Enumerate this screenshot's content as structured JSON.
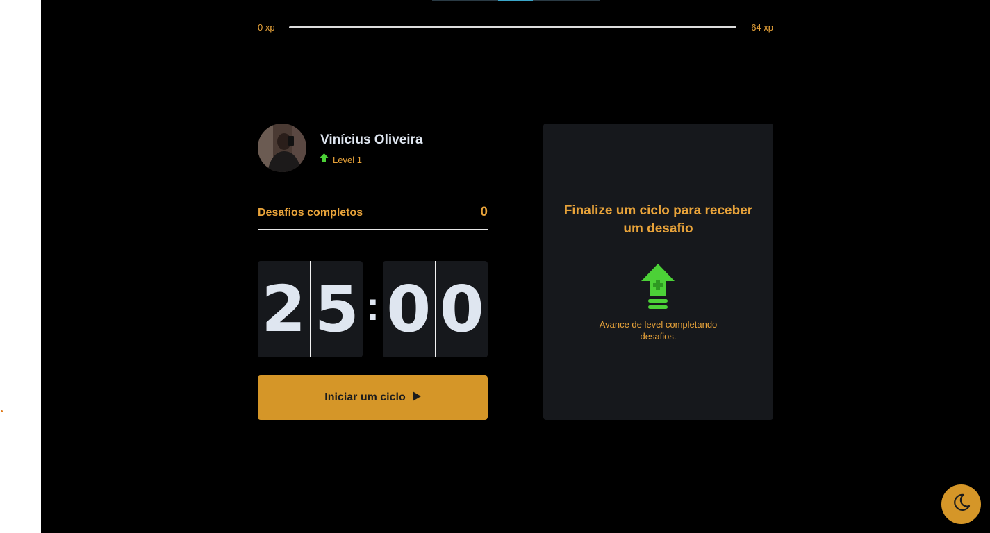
{
  "experience": {
    "min_label": "0 xp",
    "max_label": "64 xp",
    "progress_percent": 0
  },
  "profile": {
    "name": "Vinícius Oliveira",
    "level_label": "Level 1",
    "avatar_icon": "user-avatar-photo"
  },
  "stats": {
    "completed_label": "Desafios completos",
    "completed_count": "0"
  },
  "countdown": {
    "minute_left": "2",
    "minute_right": "5",
    "separator": ":",
    "second_left": "0",
    "second_right": "0"
  },
  "start_button": {
    "label": "Iniciar um ciclo",
    "icon": "play-icon"
  },
  "challenge_box": {
    "title": "Finalize um ciclo para receber um desafio",
    "icon": "level-up-icon",
    "description": "Avance de level completando desafios."
  },
  "theme_toggle": {
    "icon": "moon-icon"
  },
  "colors": {
    "accent": "#d59628",
    "accent_text": "#e8a33a",
    "success": "#4cd137",
    "panel": "#16181c",
    "background": "#000000"
  }
}
